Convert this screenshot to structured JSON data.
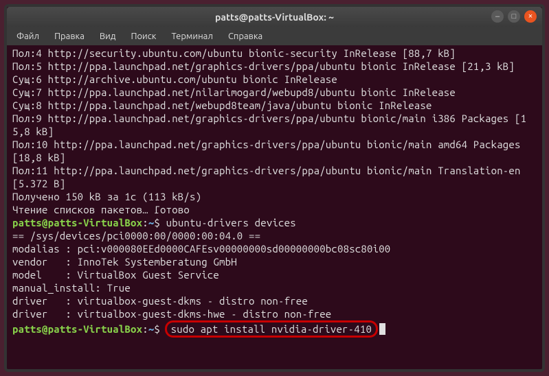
{
  "window": {
    "title": "patts@patts-VirtualBox: ~",
    "controls": {
      "min": "–",
      "max": "□",
      "close": "×"
    }
  },
  "menu": {
    "file": "Файл",
    "edit": "Правка",
    "view": "Вид",
    "search": "Поиск",
    "terminal": "Терминал",
    "help": "Справка"
  },
  "prompt": {
    "userhost": "patts@patts-VirtualBox",
    "sep": ":",
    "path": "~",
    "symbol": "$"
  },
  "output": {
    "l1": "Пол:4 http://security.ubuntu.com/ubuntu bionic-security InRelease [88,7 kB]",
    "l2": "Пол:5 http://ppa.launchpad.net/graphics-drivers/ppa/ubuntu bionic InRelease [21,3 kB]",
    "l3": "Сущ:6 http://archive.ubuntu.com/ubuntu bionic InRelease",
    "l4": "Сущ:7 http://ppa.launchpad.net/nilarimogard/webupd8/ubuntu bionic InRelease",
    "l5": "Сущ:8 http://ppa.launchpad.net/webupd8team/java/ubuntu bionic InRelease",
    "l6": "Пол:9 http://ppa.launchpad.net/graphics-drivers/ppa/ubuntu bionic/main i386 Packages [15,8 kB]",
    "l7": "Пол:10 http://ppa.launchpad.net/graphics-drivers/ppa/ubuntu bionic/main amd64 Packages [18,8 kB]",
    "l8": "Пол:11 http://ppa.launchpad.net/graphics-drivers/ppa/ubuntu bionic/main Translation-en [5.372 B]",
    "l9": "Получено 150 kB за 1с (113 kB/s)",
    "l10": "Чтение списков пакетов… Готово",
    "cmd1": "ubuntu-drivers devices",
    "l11": "== /sys/devices/pci0000:00/0000:00:04.0 ==",
    "l12": "modalias : pci:v000080EEd0000CAFEsv00000000sd00000000bc08sc80i00",
    "l13": "vendor   : InnoTek Systemberatung GmbH",
    "l14": "model    : VirtualBox Guest Service",
    "l15": "manual_install: True",
    "l16": "driver   : virtualbox-guest-dkms - distro non-free",
    "l17": "driver   : virtualbox-guest-dkms-hwe - distro non-free",
    "blank": "",
    "cmd2": "sudo apt install nvidia-driver-410"
  }
}
